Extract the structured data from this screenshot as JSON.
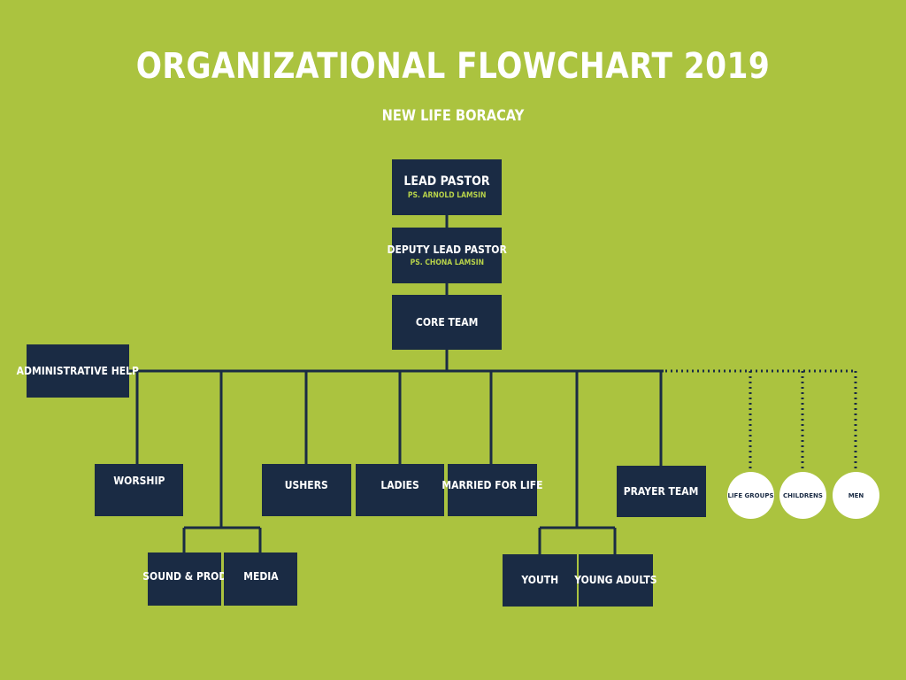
{
  "header": {
    "title": "ORGANIZATIONAL FLOWCHART 2019",
    "subtitle": "NEW LIFE BORACAY"
  },
  "colors": {
    "background": "#abc33f",
    "box": "#1a2b44",
    "box_text": "#ffffff",
    "name_text": "#b7d24a",
    "circle": "#ffffff"
  },
  "nodes": {
    "lead_pastor": {
      "label": "LEAD PASTOR",
      "name": "PS. ARNOLD LAMSIN"
    },
    "deputy_lead_pastor": {
      "label": "DEPUTY LEAD PASTOR",
      "name": "PS. CHONA LAMSIN"
    },
    "core_team": {
      "label": "CORE TEAM"
    },
    "administrative_help": {
      "label": "ADMINISTRATIVE HELP"
    },
    "worship": {
      "label": "WORSHIP"
    },
    "ushers": {
      "label": "USHERS"
    },
    "ladies": {
      "label": "LADIES"
    },
    "married_for_life": {
      "label": "MARRIED FOR LIFE"
    },
    "prayer_team": {
      "label": "PRAYER TEAM"
    },
    "sound_prod": {
      "label": "SOUND & PROD"
    },
    "media": {
      "label": "MEDIA"
    },
    "youth": {
      "label": "YOUTH"
    },
    "young_adults": {
      "label": "YOUNG ADULTS"
    }
  },
  "circles": {
    "life_groups": "LIFE GROUPS",
    "childrens": "CHILDRENS",
    "men": "MEN"
  }
}
